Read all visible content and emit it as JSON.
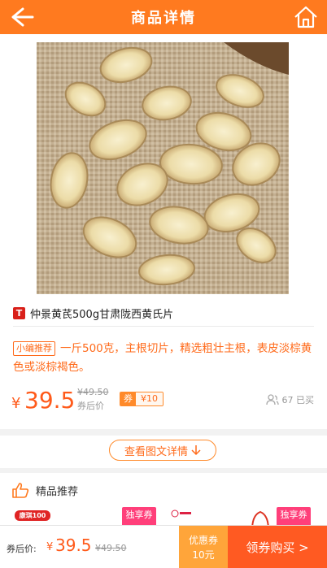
{
  "header": {
    "title": "商品详情",
    "back_icon": "arrow-left-icon",
    "home_icon": "home-icon"
  },
  "product": {
    "platform_badge": "T",
    "name": "仲景黄芪500g甘肃陇西黄氏片",
    "editor_tag": "小编推荐",
    "description": "一斤500克，主根切片，精选粗壮主根，表皮淡棕黄色或淡棕褐色。",
    "currency": "¥",
    "price": "39.5",
    "original_price": "¥49.50",
    "after_coupon_label": "券后价",
    "coupon_label": "券",
    "coupon_value": "¥10",
    "sold": "67 已买"
  },
  "detail_button": {
    "label": "查看图文详情"
  },
  "recommend": {
    "title": "精品推荐",
    "logo_text": "康琪100",
    "exclusive_label": "独享券"
  },
  "bottom_bar": {
    "after_coupon_label": "券后价:",
    "currency": "¥",
    "price": "39.5",
    "original_price": "¥49.50",
    "coupon_label": "优惠券",
    "coupon_value": "10元",
    "buy_label": "领券购买 >"
  },
  "colors": {
    "primary": "#ff7a1f",
    "price": "#ff5a1a",
    "badge_red": "#d9201a",
    "exclusive": "#ff3f7a"
  }
}
